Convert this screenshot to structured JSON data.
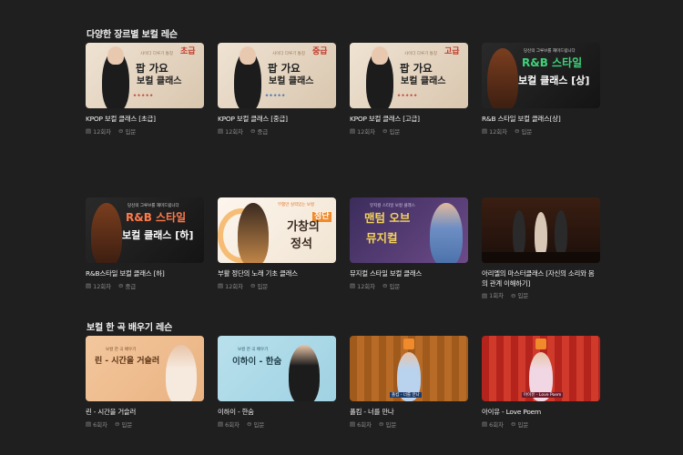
{
  "sections": [
    {
      "title": "다양한 장르별 보컬 레슨",
      "cards": [
        {
          "title": "KPOP 보컬 클래스 [초급]",
          "sessions": "12회차",
          "level": "입문",
          "thumb_text": [
            "팝 가요",
            "보컬 클래스"
          ],
          "thumb_tag": "초급",
          "thumb_note": "사이다 다루기 통칭"
        },
        {
          "title": "KPOP 보컬 클래스 [중급]",
          "sessions": "12회차",
          "level": "중급",
          "thumb_text": [
            "팝 가요",
            "보컬 클래스"
          ],
          "thumb_tag": "중급",
          "thumb_note": "사이다 다루기 통칭"
        },
        {
          "title": "KPOP 보컬 클래스 [고급]",
          "sessions": "12회차",
          "level": "입문",
          "thumb_text": [
            "팝 가요",
            "보컬 클래스"
          ],
          "thumb_tag": "고급",
          "thumb_note": "사이다 다루기 통칭"
        },
        {
          "title": "R&B 스타일 보컬 클래스[상]",
          "sessions": "12회차",
          "level": "입문",
          "thumb_text": [
            "R&B 스타일",
            "보컬 클래스 [상]"
          ],
          "thumb_note": "당신의 그루브를 재미드립니다"
        },
        {
          "title": "R&B스타일 보컬 클래스 [하]",
          "sessions": "12회차",
          "level": "중급",
          "thumb_text": [
            "R&B 스타일",
            "보컬 클래스 [하]"
          ],
          "thumb_note": "당신의 그루브를 재미드립니다"
        },
        {
          "title": "부활 정단의 노래 기초 클래스",
          "sessions": "12회차",
          "level": "입문",
          "thumb_text": [
            "가창의",
            "정석"
          ],
          "thumb_tag": "정단",
          "thumb_note": "부활만 실력있는 보컬"
        },
        {
          "title": "뮤지컬 스타일 보컬 클래스",
          "sessions": "12회차",
          "level": "입문",
          "thumb_text": [
            "맨텀 오브",
            "뮤지컬"
          ],
          "thumb_note": "뮤지컬 스타일 보컬 클래스"
        },
        {
          "title": "아리엘의 마스터클래스 [자신의 소리와 몸의 관계 이해하기]",
          "sessions": "1회차",
          "level": "입문"
        }
      ]
    },
    {
      "title": "보컬 한 곡 배우기 레슨",
      "cards": [
        {
          "title": "린 - 시간을 거슬러",
          "sessions": "6회차",
          "level": "입문",
          "thumb_text": [
            "린 - 시간을 거슬러"
          ],
          "thumb_note": "보컬 한 곡 배우기"
        },
        {
          "title": "이하이 - 한숨",
          "sessions": "6회차",
          "level": "입문",
          "thumb_text": [
            "이하이 - 한숨"
          ],
          "thumb_note": "보컬 한 곡 배우기"
        },
        {
          "title": "폴킴 - 너를 만나",
          "sessions": "6회차",
          "level": "입문",
          "thumb_note": "폴킴 - 너를 만나"
        },
        {
          "title": "아이유 - Love Poem",
          "sessions": "6회차",
          "level": "입문",
          "thumb_note": "아이유 - Love Poem"
        }
      ]
    }
  ],
  "icons": {
    "sessions": "document-icon",
    "level": "circle-icon"
  },
  "colors": {
    "background": "#1f1f1f",
    "meta": "#8b8b8b",
    "text": "#f2f2f2"
  }
}
